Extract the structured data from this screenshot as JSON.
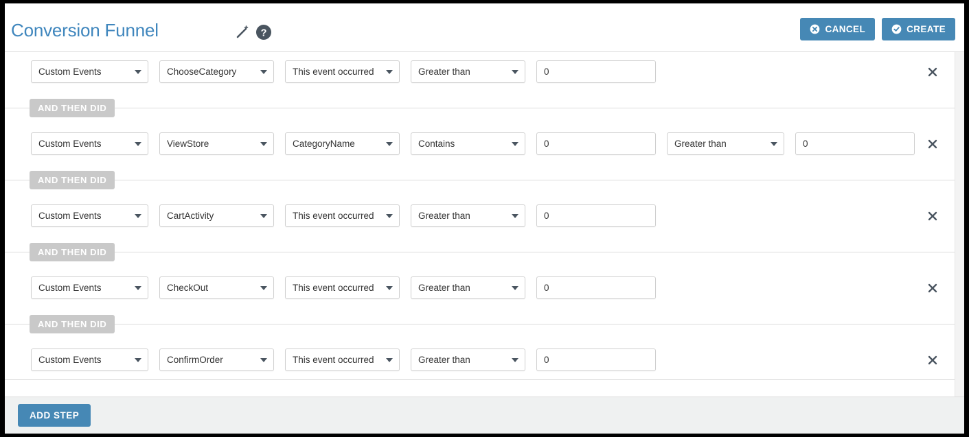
{
  "header": {
    "title": "Conversion Funnel",
    "wand_icon": "magic-wand-icon",
    "help_icon": "help-circle-icon",
    "cancel_label": "CANCEL",
    "create_label": "CREATE",
    "accent_blue": "#4688b5",
    "title_blue": "#3f86bd"
  },
  "connector_label": "AND THEN DID",
  "remove_icon": "close-icon",
  "steps": [
    {
      "source": "Custom Events",
      "event": "ChooseCategory",
      "property": "This event occurred",
      "condition": "Greater than",
      "value": "0",
      "has_extra": false
    },
    {
      "source": "Custom Events",
      "event": "ViewStore",
      "property": "CategoryName",
      "condition": "Contains",
      "value": "0",
      "has_extra": true,
      "condition2": "Greater than",
      "value2": "0"
    },
    {
      "source": "Custom Events",
      "event": "CartActivity",
      "property": "This event occurred",
      "condition": "Greater than",
      "value": "0",
      "has_extra": false
    },
    {
      "source": "Custom Events",
      "event": "CheckOut",
      "property": "This event occurred",
      "condition": "Greater than",
      "value": "0",
      "has_extra": false
    },
    {
      "source": "Custom Events",
      "event": "ConfirmOrder",
      "property": "This event occurred",
      "condition": "Greater than",
      "value": "0",
      "has_extra": false
    }
  ],
  "footer": {
    "add_step_label": "ADD STEP"
  }
}
